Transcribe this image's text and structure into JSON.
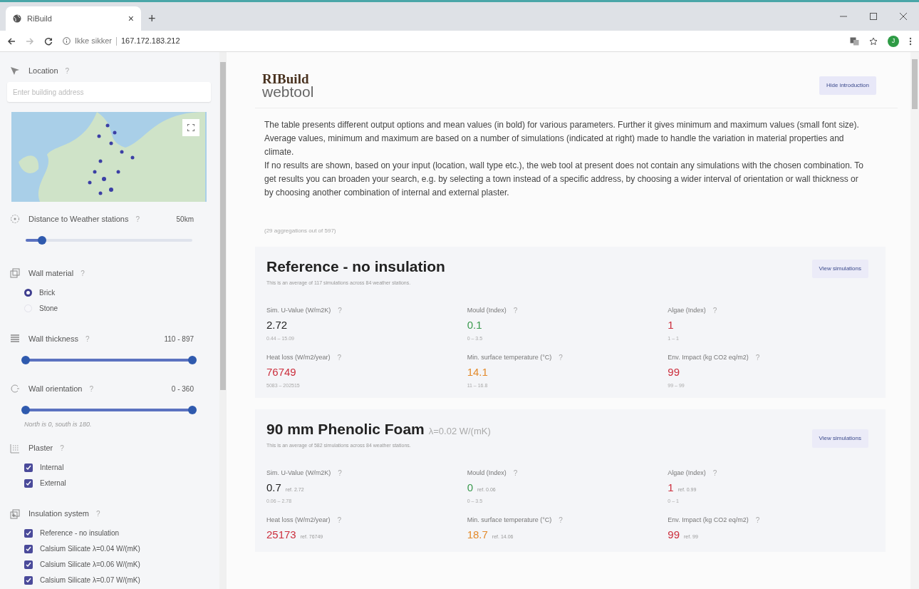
{
  "browser": {
    "tab_title": "RiBuild",
    "tab_close": "×",
    "new_tab": "+",
    "security": "Ikke sikker",
    "url": "167.172.183.212",
    "avatar": "J"
  },
  "sidebar": {
    "sections": [
      {
        "kind": "search",
        "label": "Location",
        "help": "?",
        "placeholder": "Enter building address"
      },
      {
        "kind": "slider",
        "label": "Distance to Weather stations",
        "help": "?",
        "value": "50km",
        "level": 0.1
      },
      {
        "kind": "radio",
        "label": "Wall material",
        "help": "?",
        "options": [
          {
            "label": "Brick",
            "selected": true
          },
          {
            "label": "Stone",
            "selected": false
          }
        ]
      },
      {
        "kind": "range",
        "label": "Wall thickness",
        "help": "?",
        "value": "110 - 897",
        "level": 1
      },
      {
        "kind": "range",
        "label": "Wall orientation",
        "help": "?",
        "value": "0 - 360",
        "level": 1,
        "note": "North is 0, south is 180."
      },
      {
        "kind": "checkbox",
        "label": "Plaster",
        "help": "?",
        "options": [
          {
            "label": "Internal",
            "checked": true
          },
          {
            "label": "External",
            "checked": true
          }
        ]
      },
      {
        "kind": "checkbox",
        "label": "Insulation system",
        "help": "?",
        "options": [
          {
            "label": "Reference - no insulation",
            "checked": true
          },
          {
            "label": "Calsium Silicate λ=0.04 W/(mK)",
            "checked": true
          },
          {
            "label": "Calsium Silicate λ=0.06 W/(mK)",
            "checked": true
          },
          {
            "label": "Calsium Silicate λ=0.07 W/(mK)",
            "checked": true
          }
        ]
      }
    ]
  },
  "main": {
    "logo": {
      "name": "RIBuild",
      "sub": "webtool"
    },
    "hide_button": "Hide introduction",
    "intro": [
      "The table presents different output options and mean values (in bold) for various parameters. Further it gives minimum and maximum values (small font size). Average values, minimum and maximum are based on a number of simulations (indicated at right) made to handle the variation in material properties and climate.",
      "If no results are shown, based on your input (location, wall type etc.), the web tool at present does not contain any simulations with the chosen combination. To get results you can broaden your search, e.g. by selecting a town instead of a specific address, by choosing a wider interval of orientation or wall thickness or by choosing another combination of internal and external plaster."
    ],
    "count": "(29 aggregations out of 597)",
    "cards": [
      {
        "title": "Reference - no insulation",
        "subtitle": "This is an average of 117 simulations across 84 weather stations.",
        "button": "View simulations",
        "metrics": [
          {
            "label": "Sim. U-Value (W/m2K)",
            "help": "?",
            "value": "2.72",
            "color": "#222222",
            "range": "0.44 – 15.09"
          },
          {
            "label": "Mould (Index)",
            "help": "?",
            "value": "0.1",
            "color": "#3a9a4e",
            "range": "0 – 3.5"
          },
          {
            "label": "Algae (Index)",
            "help": "?",
            "value": "1",
            "color": "#cc2f3d",
            "range": "1 – 1"
          },
          {
            "label": "Heat loss (W/m2/year)",
            "help": "?",
            "value": "76749",
            "color": "#cc2f3d",
            "range": "5083 – 202515"
          },
          {
            "label": "Min. surface temperature (°C)",
            "help": "?",
            "value": "14.1",
            "color": "#e38b2c",
            "range": "11 – 16.8"
          },
          {
            "label": "Env. Impact (kg CO2 eq/m2)",
            "help": "?",
            "value": "99",
            "color": "#cc2f3d",
            "range": "99 – 99"
          }
        ]
      },
      {
        "title": "90 mm Phenolic Foam",
        "title_note": "λ=0.02 W/(mK)",
        "subtitle": "This is an average of 582 simulations across 84 weather stations.",
        "button": "View simulations",
        "metrics": [
          {
            "label": "Sim. U-Value (W/m2K)",
            "help": "?",
            "value": "0.7",
            "ref": "ref. 2.72",
            "color": "#222222",
            "range": "0.06 – 2.78"
          },
          {
            "label": "Mould (Index)",
            "help": "?",
            "value": "0",
            "ref": "ref. 0.06",
            "color": "#3a9a4e",
            "range": "0 – 3.5"
          },
          {
            "label": "Algae (Index)",
            "help": "?",
            "value": "1",
            "ref": "ref. 0.99",
            "color": "#cc2f3d",
            "range": "0 – 1"
          },
          {
            "label": "Heat loss (W/m2/year)",
            "help": "?",
            "value": "25173",
            "ref": "ref. 76749",
            "color": "#cc2f3d"
          },
          {
            "label": "Min. surface temperature (°C)",
            "help": "?",
            "value": "18.7",
            "ref": "ref. 14.06",
            "color": "#e38b2c"
          },
          {
            "label": "Env. Impact (kg CO2 eq/m2)",
            "help": "?",
            "value": "99",
            "ref": "ref. 99",
            "color": "#cc2f3d"
          }
        ]
      }
    ]
  }
}
